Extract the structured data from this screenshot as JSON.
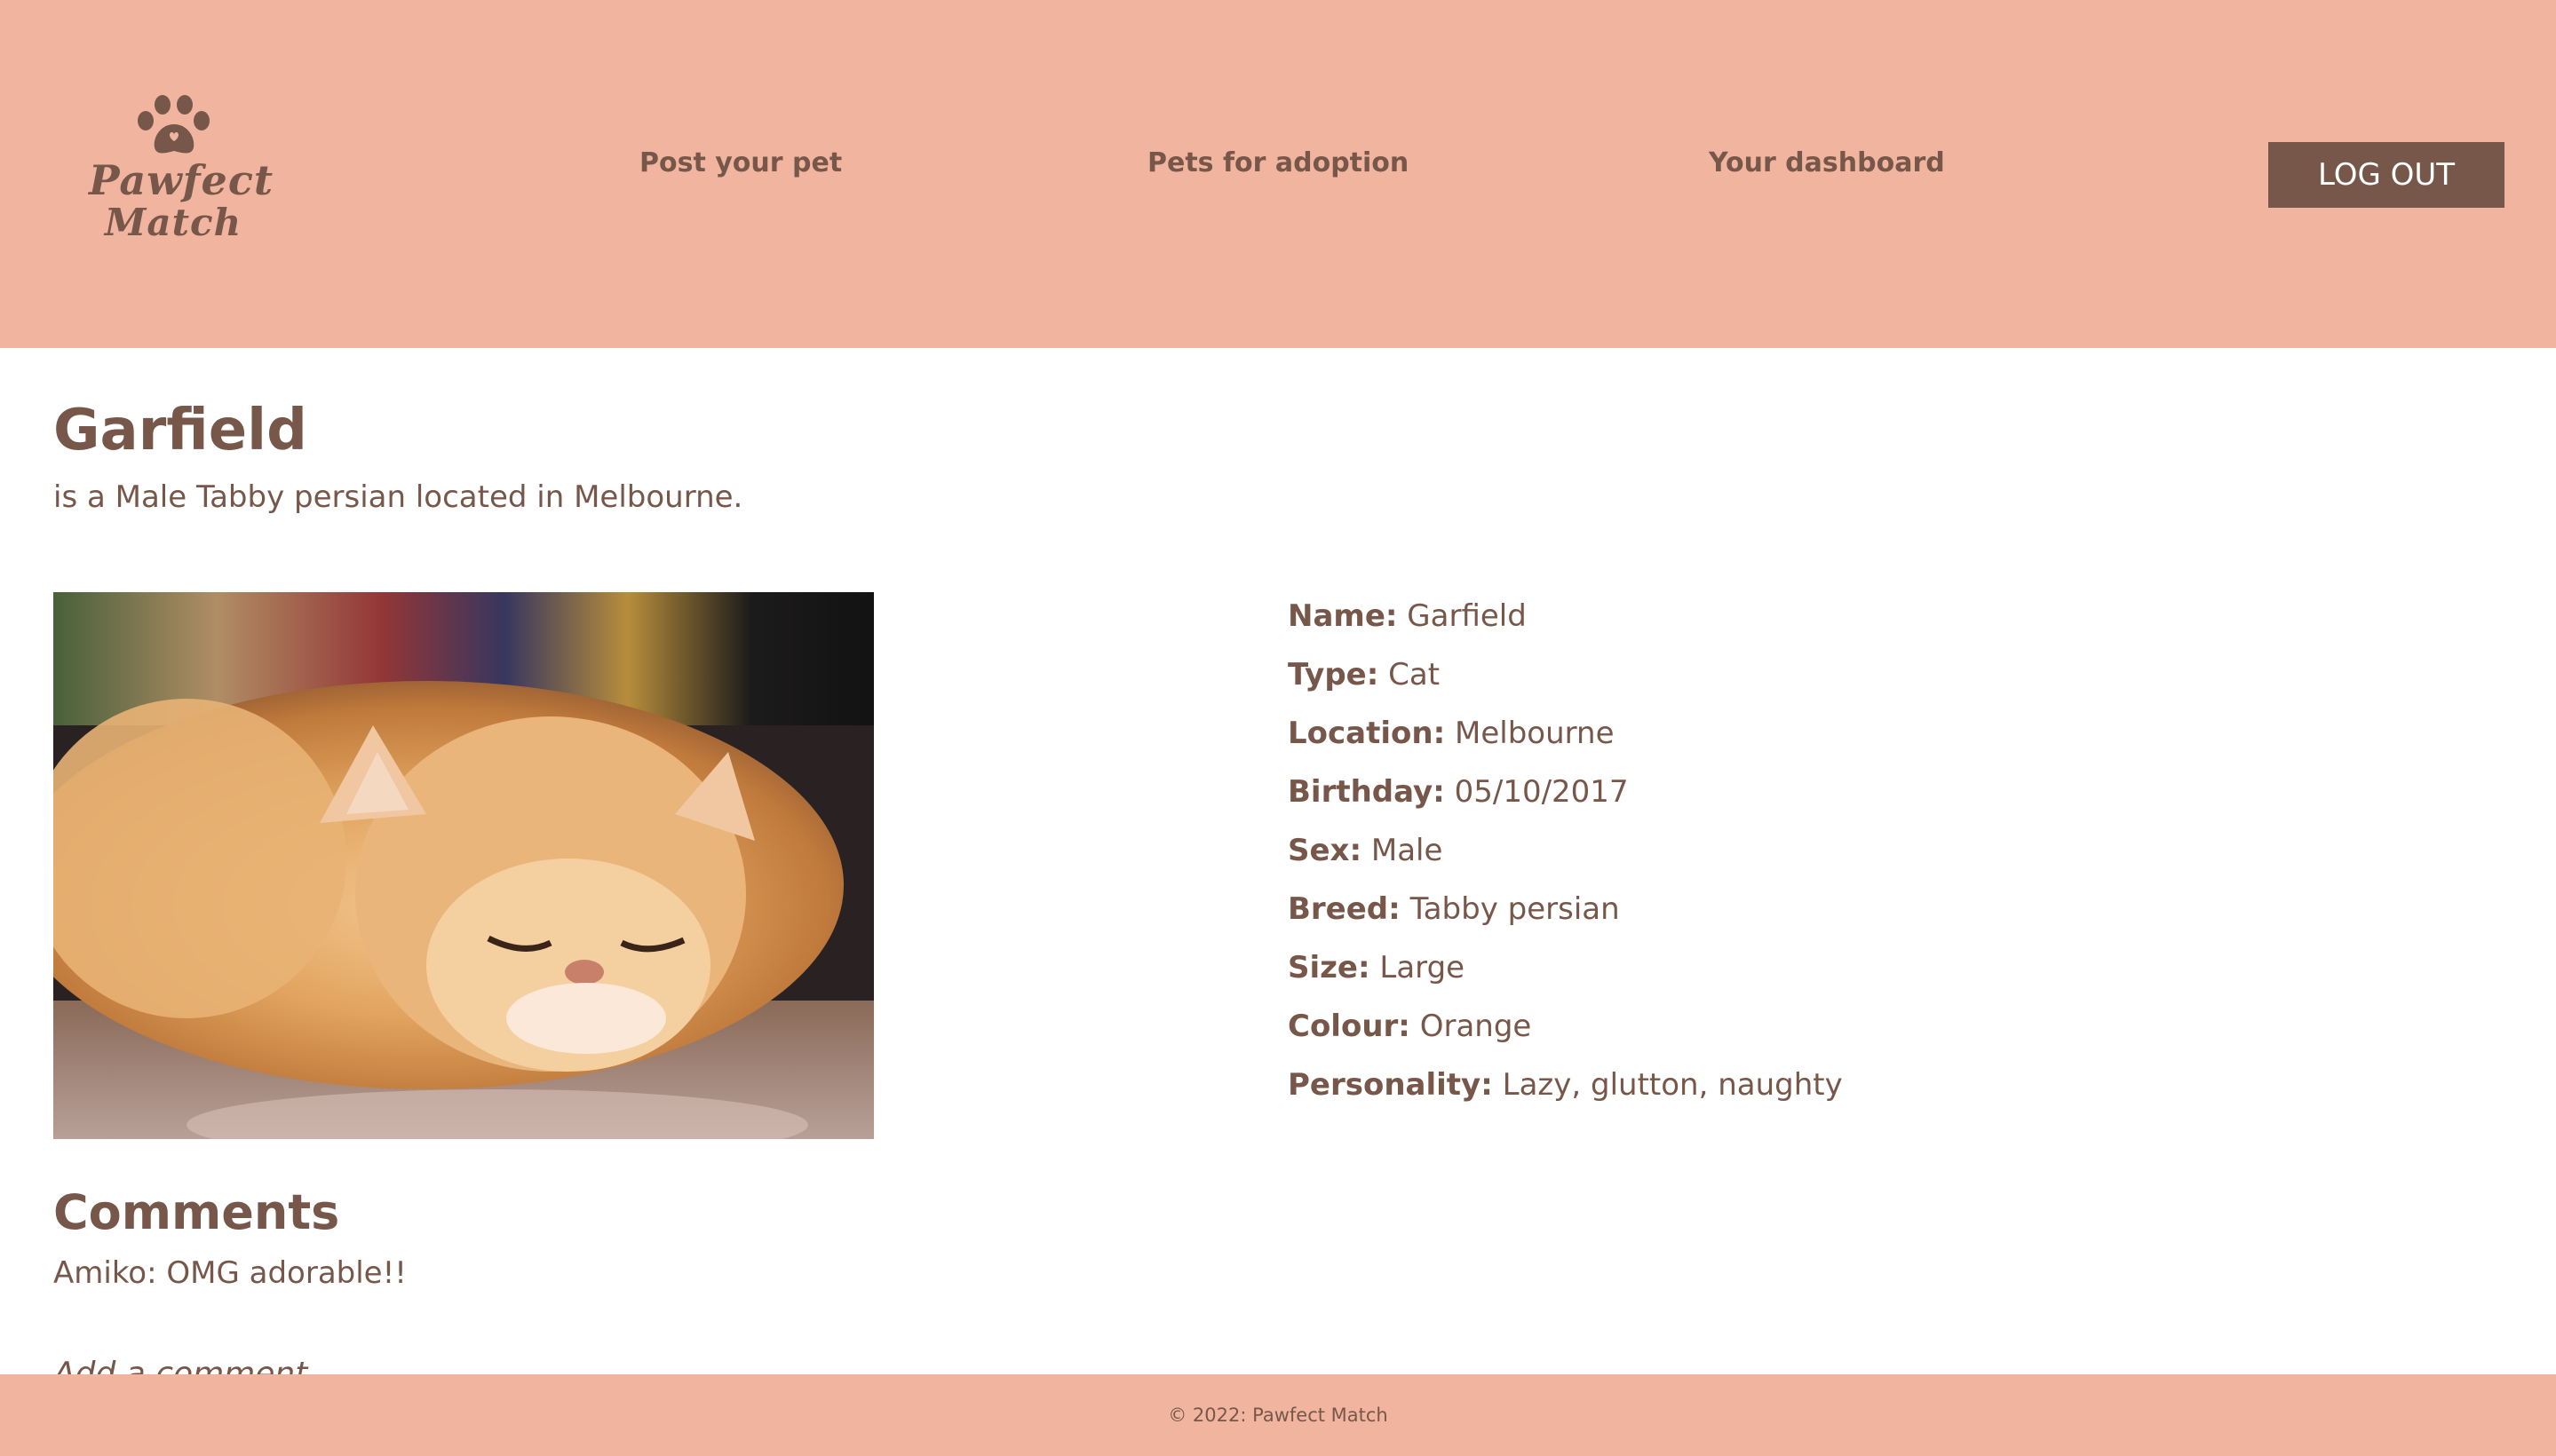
{
  "colors": {
    "header_bg": "#f1b59f",
    "brand_brown": "#77574a",
    "footer_bg": "#f1b59f",
    "button_text": "#ffffff"
  },
  "header": {
    "logo": {
      "line1": "Pawfect",
      "line2": "Match",
      "icon": "paw-icon"
    },
    "nav": [
      {
        "label": "Post your pet"
      },
      {
        "label": "Pets for adoption"
      },
      {
        "label": "Your dashboard"
      }
    ],
    "logout_label": "LOG OUT"
  },
  "pet": {
    "name": "Garfield",
    "summary": "is a Male Tabby persian located in Melbourne.",
    "photo_alt": "orange-persian-cat-photo",
    "details": [
      {
        "label": "Name:",
        "value": "Garfield"
      },
      {
        "label": "Type:",
        "value": "Cat"
      },
      {
        "label": "Location:",
        "value": "Melbourne"
      },
      {
        "label": "Birthday:",
        "value": "05/10/2017"
      },
      {
        "label": "Sex:",
        "value": "Male"
      },
      {
        "label": "Breed:",
        "value": "Tabby persian"
      },
      {
        "label": "Size:",
        "value": "Large"
      },
      {
        "label": "Colour:",
        "value": "Orange"
      },
      {
        "label": "Personality:",
        "value": "Lazy, glutton, naughty"
      }
    ]
  },
  "comments": {
    "title": "Comments",
    "items": [
      {
        "text": "Amiko: OMG adorable!!"
      }
    ],
    "input_placeholder": "Add a comment"
  },
  "footer": {
    "text": "© 2022: Pawfect Match"
  }
}
